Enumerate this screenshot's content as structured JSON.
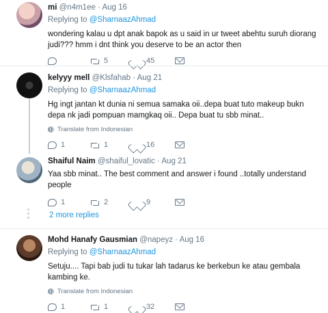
{
  "tweets": [
    {
      "name": "mi",
      "handle": "@n4m1ee",
      "date": "Aug 16",
      "replying_label": "Replying to ",
      "replying_to": "@SharnaazAhmad",
      "text": "wondering kalau u dpt anak bapok as u said in ur tweet abehtu suruh diorang judi??? hmm i dnt think you deserve to be an actor then",
      "translate": "",
      "replies": "",
      "retweets": "5",
      "likes": "45"
    },
    {
      "name": "kelyyy mell",
      "handle": "@Klsfahab",
      "date": "Aug 21",
      "replying_label": "Replying to ",
      "replying_to": "@SharnaazAhmad",
      "text": "Hg ingt jantan kt dunia ni semua samaka oii..depa buat tuto makeup bukn depa nk jadi pompuan mamgkaq oii.. Depa buat tu sbb minat..",
      "translate": "Translate from Indonesian",
      "replies": "1",
      "retweets": "1",
      "likes": "16"
    },
    {
      "name": "Shaiful Naim",
      "handle": "@shaiful_lovatic",
      "date": "Aug 21",
      "replying_label": "",
      "replying_to": "",
      "text": "Yaa sbb minat.. The best comment and answer i found ..totally understand people",
      "translate": "",
      "replies": "1",
      "retweets": "2",
      "likes": "9"
    },
    {
      "name": "Mohd Hanafy Gausmian",
      "handle": "@napeyz",
      "date": "Aug 16",
      "replying_label": "Replying to ",
      "replying_to": "@SharnaazAhmad",
      "text": "Setuju.... Tapi bab judi tu tukar lah tadarus ke berkebun ke atau gembala kambing ke.",
      "translate": "Translate from Indonesian",
      "replies": "1",
      "retweets": "1",
      "likes": "32"
    }
  ],
  "more_replies": "2 more replies",
  "separator": "·"
}
